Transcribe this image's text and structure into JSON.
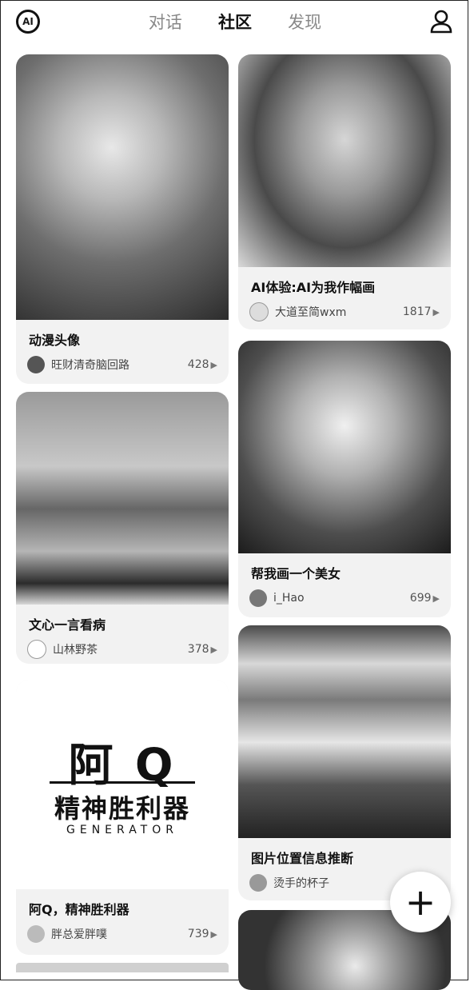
{
  "header": {
    "logo_text": "AI",
    "tabs": [
      {
        "label": "对话"
      },
      {
        "label": "社区"
      },
      {
        "label": "发现"
      }
    ],
    "active_tab": "社区"
  },
  "aq_cover": {
    "big": "阿 Q",
    "sub": "精神胜利器",
    "generator": "GENERATOR"
  },
  "cards": [
    {
      "title": "动漫头像",
      "author": "旺财清奇脑回路",
      "count": "428"
    },
    {
      "title": "AI体验:AI为我作幅画",
      "author": "大道至简wxm",
      "count": "1817"
    },
    {
      "title": "文心一言看病",
      "author": "山林野茶",
      "count": "378"
    },
    {
      "title": "帮我画一个美女",
      "author": "i_Hao",
      "count": "699"
    },
    {
      "title": "阿Q，精神胜利器",
      "author": "胖总爱胖噗",
      "count": "739"
    },
    {
      "title": "图片位置信息推断",
      "author": "烫手的杯子",
      "count": ""
    }
  ],
  "icons": {
    "logo": "ai-logo-icon",
    "user": "user-icon",
    "arrow": "play-arrow-icon",
    "fab": "plus-icon"
  },
  "fab_symbol": "+",
  "arrow_symbol": "▶"
}
